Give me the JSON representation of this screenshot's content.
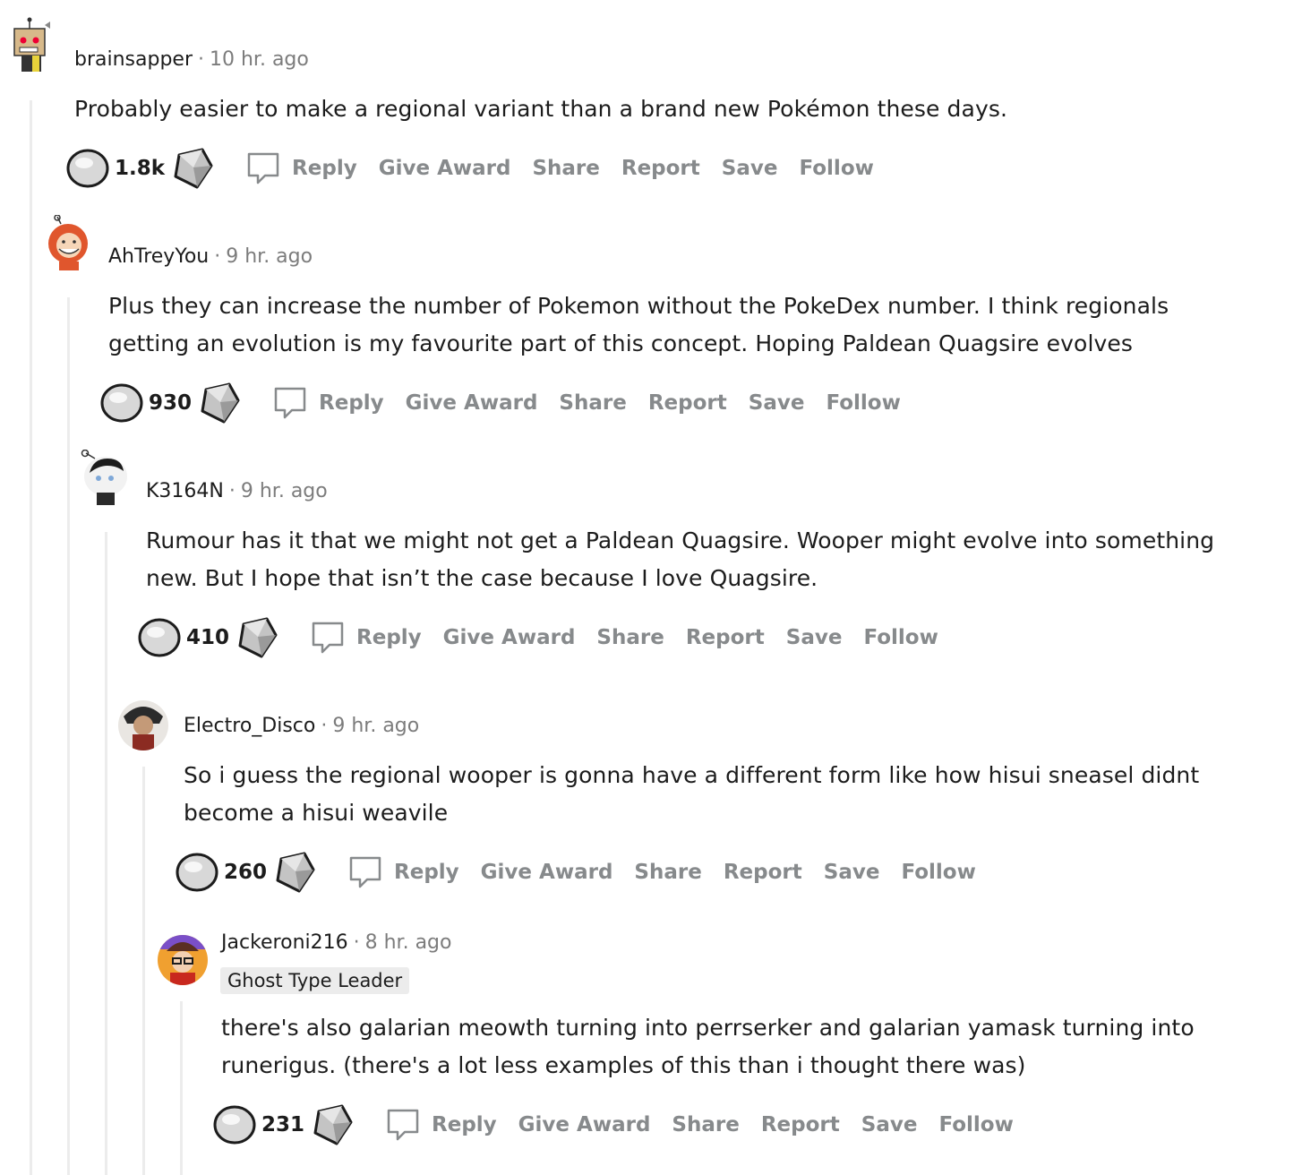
{
  "comments": [
    {
      "author": "brainsapper",
      "time": "10 hr. ago",
      "flair": "",
      "body": "Probably easier to make a regional variant than a brand new Pokémon these days.",
      "score": "1.8k",
      "avatar": "robot-box-avatar"
    },
    {
      "author": "AhTreyYou",
      "time": "9 hr. ago",
      "flair": "",
      "body": "Plus they can increase the number of Pokemon without the PokeDex number. I think regionals getting an evolution is my favourite part of this concept. Hoping Paldean Quagsire evolves",
      "score": "930",
      "avatar": "red-hood-avatar"
    },
    {
      "author": "K3164N",
      "time": "9 hr. ago",
      "flair": "",
      "body": "Rumour has it that we might not get a Paldean Quagsire. Wooper might evolve into something new. But I hope that isn’t the case because I love Quagsire.",
      "score": "410",
      "avatar": "snoo-avatar"
    },
    {
      "author": "Electro_Disco",
      "time": "9 hr. ago",
      "flair": "",
      "body": "So i guess the regional wooper is gonna have a different form like how hisui sneasel didnt become a hisui weavile",
      "score": "260",
      "avatar": "photo-avatar"
    },
    {
      "author": "Jackeroni216",
      "time": "8 hr. ago",
      "flair": "Ghost Type Leader",
      "body": "there's also galarian meowth turning into perrserker and galarian yamask turning into runerigus. (there's a lot less examples of this than i thought there was)",
      "score": "231",
      "avatar": "glasses-avatar"
    }
  ],
  "actions": {
    "reply": "Reply",
    "give_award": "Give Award",
    "share": "Share",
    "report": "Report",
    "save": "Save",
    "follow": "Follow"
  },
  "separator": "·"
}
